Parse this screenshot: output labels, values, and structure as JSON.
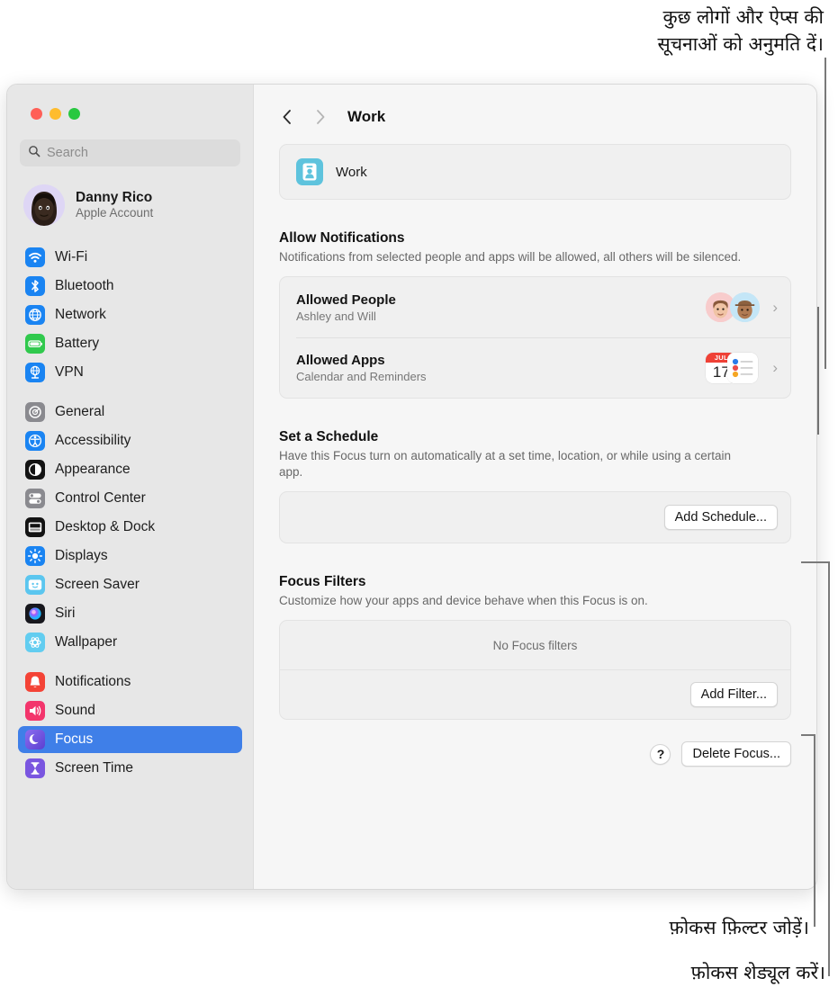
{
  "callouts": {
    "top": [
      "कुछ लोगों और ऐप्स की",
      "सूचनाओं को अनुमति दें।"
    ],
    "top_line1": "कुछ लोगों और ऐप्स की",
    "top_line2": "सूचनाओं को अनुमति दें।",
    "add_filter": "फ़ोकस फ़िल्टर जोड़ें।",
    "add_schedule": "फ़ोकस शेड्यूल करें।"
  },
  "window": {
    "traffic_lights": [
      {
        "name": "close",
        "color": "#FF5F57"
      },
      {
        "name": "minimize",
        "color": "#FEBC2E"
      },
      {
        "name": "zoom",
        "color": "#28C840"
      }
    ]
  },
  "sidebar": {
    "search": {
      "placeholder": "Search",
      "value": "",
      "icon": "search-icon"
    },
    "account": {
      "name": "Danny Rico",
      "subtitle": "Apple Account",
      "avatar": "memoji-avatar"
    },
    "groups": [
      {
        "items": [
          {
            "label": "Wi-Fi",
            "icon": "wifi-icon",
            "color": "#1a84f2",
            "selected": false
          },
          {
            "label": "Bluetooth",
            "icon": "bluetooth-icon",
            "color": "#1a84f2",
            "selected": false
          },
          {
            "label": "Network",
            "icon": "network-globe-icon",
            "color": "#1a84f2",
            "selected": false
          },
          {
            "label": "Battery",
            "icon": "battery-icon",
            "color": "#30c94d",
            "selected": false
          },
          {
            "label": "VPN",
            "icon": "vpn-icon",
            "color": "#1a84f2",
            "selected": false
          }
        ]
      },
      {
        "items": [
          {
            "label": "General",
            "icon": "gear-icon",
            "color": "#8a8a8f",
            "selected": false
          },
          {
            "label": "Accessibility",
            "icon": "accessibility-icon",
            "color": "#1a84f2",
            "selected": false
          },
          {
            "label": "Appearance",
            "icon": "appearance-icon",
            "color": "#131313",
            "selected": false
          },
          {
            "label": "Control Center",
            "icon": "control-center-icon",
            "color": "#8a8a8f",
            "selected": false
          },
          {
            "label": "Desktop & Dock",
            "icon": "desktop-dock-icon",
            "color": "#131313",
            "selected": false
          },
          {
            "label": "Displays",
            "icon": "displays-icon",
            "color": "#1a84f2",
            "selected": false
          },
          {
            "label": "Screen Saver",
            "icon": "screen-saver-icon",
            "color": "#5bc6ef",
            "selected": false
          },
          {
            "label": "Siri",
            "icon": "siri-icon",
            "color": "#1c1c22",
            "selected": false
          },
          {
            "label": "Wallpaper",
            "icon": "wallpaper-icon",
            "color": "#62cdf0",
            "selected": false
          }
        ]
      },
      {
        "items": [
          {
            "label": "Notifications",
            "icon": "notifications-bell-icon",
            "color": "#f44336",
            "selected": false
          },
          {
            "label": "Sound",
            "icon": "sound-speaker-icon",
            "color": "#f3356c",
            "selected": false
          },
          {
            "label": "Focus",
            "icon": "focus-moon-icon",
            "color": "#6a54d6",
            "selected": true
          },
          {
            "label": "Screen Time",
            "icon": "screen-time-hourglass-icon",
            "color": "#7a56e0",
            "selected": false
          }
        ]
      }
    ]
  },
  "main": {
    "nav": {
      "back": "‹",
      "forward": "›"
    },
    "title": "Work",
    "focus_card": {
      "name": "Work",
      "icon": "work-badge-icon",
      "icon_color": "#5ec3dd"
    },
    "allow_notifications": {
      "title": "Allow Notifications",
      "description": "Notifications from selected people and apps will be allowed, all others will be silenced.",
      "rows": [
        {
          "title": "Allowed People",
          "subtitle": "Ashley and Will",
          "accessory": "avatar-group",
          "disclosure": "›"
        },
        {
          "title": "Allowed Apps",
          "subtitle": "Calendar and Reminders",
          "accessory": "app-icon-group",
          "calendar_month": "JUL",
          "calendar_day": "17",
          "disclosure": "›"
        }
      ]
    },
    "set_schedule": {
      "title": "Set a Schedule",
      "description": "Have this Focus turn on automatically at a set time, location, or while using a certain app.",
      "button": "Add Schedule..."
    },
    "focus_filters": {
      "title": "Focus Filters",
      "description": "Customize how your apps and device behave when this Focus is on.",
      "empty_text": "No Focus filters",
      "button": "Add Filter..."
    },
    "bottom": {
      "help": "?",
      "delete": "Delete Focus..."
    }
  }
}
